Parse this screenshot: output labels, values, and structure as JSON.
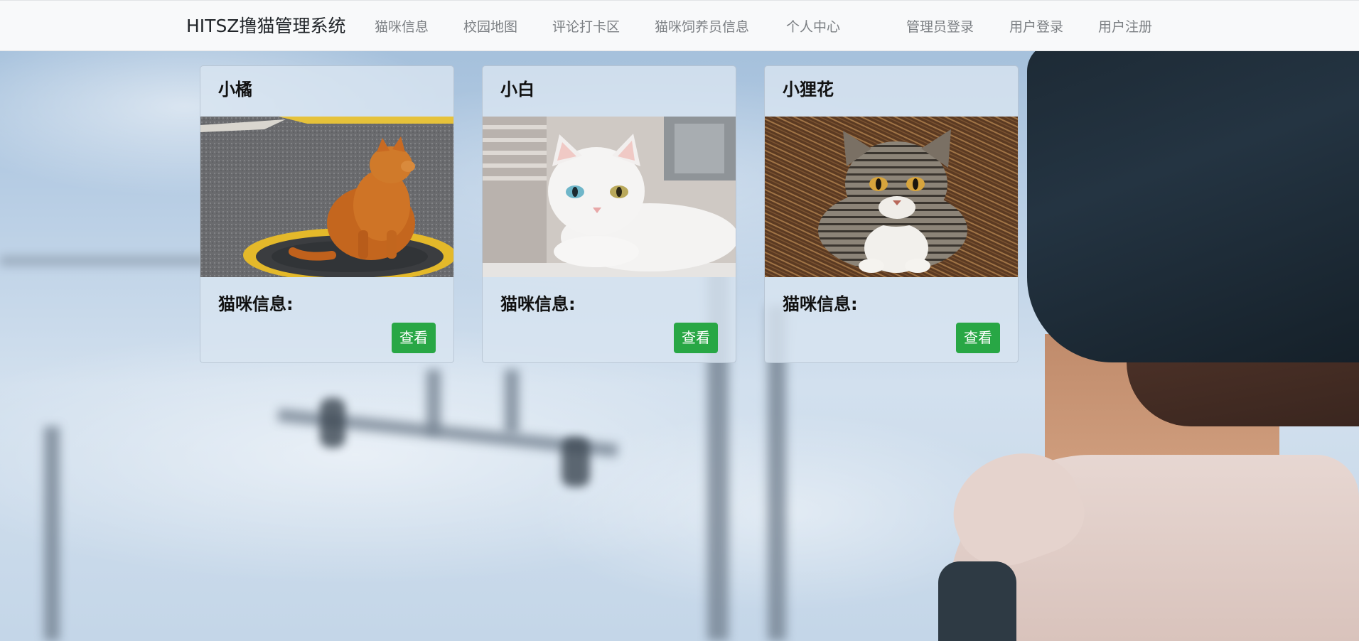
{
  "navbar": {
    "brand": "HITSZ撸猫管理系统",
    "links": [
      "猫咪信息",
      "校园地图",
      "评论打卡区",
      "猫咪饲养员信息",
      "个人中心"
    ],
    "auth_links": [
      "管理员登录",
      "用户登录",
      "用户注册"
    ]
  },
  "cards": [
    {
      "name": "小橘",
      "info_label": "猫咪信息:",
      "button_label": "查看"
    },
    {
      "name": "小白",
      "info_label": "猫咪信息:",
      "button_label": "查看"
    },
    {
      "name": "小狸花",
      "info_label": "猫咪信息:",
      "button_label": "查看"
    }
  ],
  "colors": {
    "navbar_bg": "#f8f9fa",
    "button_green": "#28a745",
    "nav_link_text": "#7b7f83"
  }
}
